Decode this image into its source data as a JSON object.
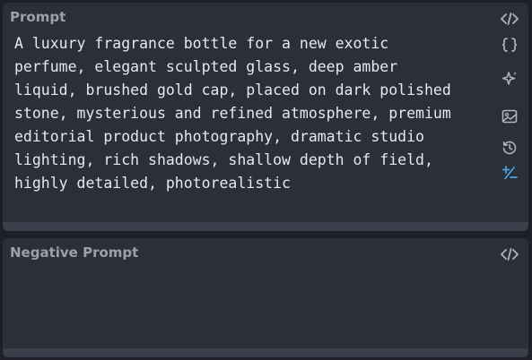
{
  "prompt_panel": {
    "title": "Prompt",
    "text": "A luxury fragrance bottle for a new exotic\nperfume, elegant sculpted glass, deep amber\nliquid, brushed gold cap, placed on dark polished\nstone, mysterious and refined atmosphere, premium\neditorial product photography, dramatic studio\nlighting, rich shadows, shallow depth of field,\nhighly detailed, photorealistic",
    "icons": [
      "code-icon",
      "braces-icon",
      "sparkle-icon",
      "image-icon",
      "history-icon",
      "plus-minus-icon"
    ]
  },
  "negative_panel": {
    "title": "Negative Prompt",
    "text": "",
    "icons": [
      "code-icon"
    ]
  },
  "colors": {
    "background": "#1f2027",
    "panel": "#2b2f39",
    "title": "#9aa0ac",
    "text": "#e6e8ec",
    "icon": "#aeb3bd",
    "accent": "#4aa8e0"
  }
}
